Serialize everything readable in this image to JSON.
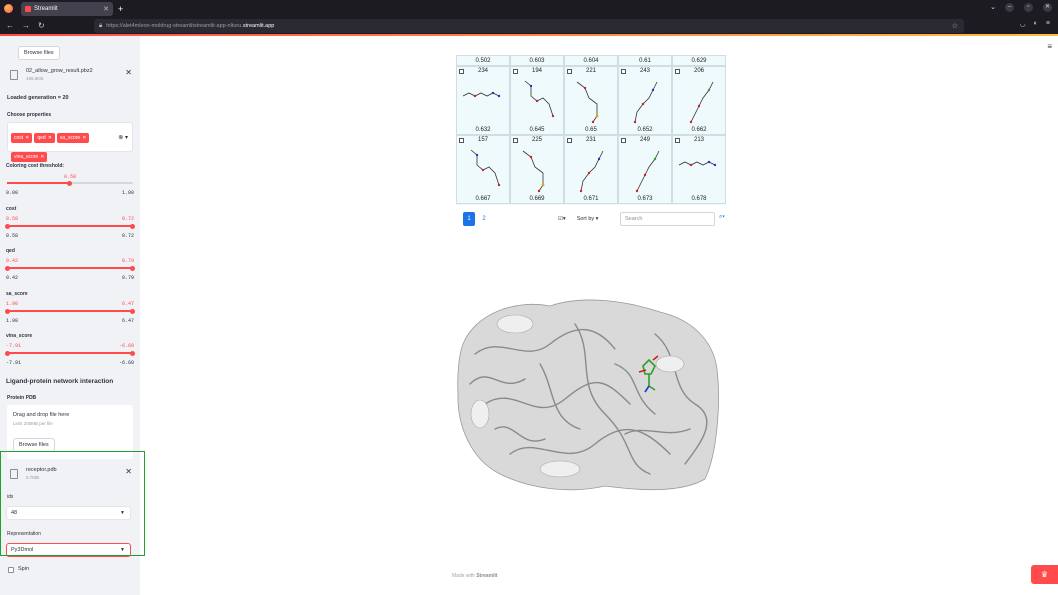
{
  "browser": {
    "tab_title": "Streamlit",
    "url_path": "https://alet4mleon-moldrug-streamlitstreamlit-app-nlturu.",
    "url_host": "streamlit.app"
  },
  "sidebar": {
    "browse_files_label": "Browse files",
    "uploaded_file": {
      "name": "02_allow_grow_result.pbz2",
      "size": "166.5KB"
    },
    "loaded_generation": "Loaded generation = 20",
    "choose_properties_label": "Choose properties",
    "properties": [
      "cost",
      "qed",
      "sa_score",
      "vina_score"
    ],
    "coloring_threshold": {
      "label": "Coloring cost threshold:",
      "value": "0.58",
      "min": "0.00",
      "max": "1.00",
      "fraction": 0.5
    },
    "range_sliders": [
      {
        "name": "cost",
        "low": "0.58",
        "high": "0.72",
        "min": "0.58",
        "max": "0.72"
      },
      {
        "name": "qed",
        "low": "0.42",
        "high": "0.79",
        "min": "0.42",
        "max": "0.79"
      },
      {
        "name": "sa_score",
        "low": "1.90",
        "high": "6.47",
        "min": "1.90",
        "max": "6.47"
      },
      {
        "name": "vina_score",
        "low": "-7.91",
        "high": "-6.60",
        "min": "-7.91",
        "max": "-6.60"
      }
    ],
    "network_header": "Ligand-protein network interaction",
    "protein_pdb_label": "Protein PDB",
    "dropzone": {
      "title": "Drag and drop file here",
      "limit": "Limit 200MB per file",
      "button": "Browse files"
    },
    "receptor_file": {
      "name": "receptor.pdb",
      "size": "0.7MB"
    },
    "idx": {
      "label": "idx",
      "value": "48"
    },
    "representation": {
      "label": "Representation",
      "value": "Py3Dmol"
    },
    "spin_label": "Spin"
  },
  "grid": {
    "top_row_scores": [
      "0.502",
      "0.603",
      "0.604",
      "0.61",
      "0.629"
    ],
    "rows": [
      [
        {
          "id": "234",
          "score": "0.632"
        },
        {
          "id": "194",
          "score": "0.645"
        },
        {
          "id": "221",
          "score": "0.65"
        },
        {
          "id": "243",
          "score": "0.652"
        },
        {
          "id": "206",
          "score": "0.662"
        }
      ],
      [
        {
          "id": "157",
          "score": "0.667"
        },
        {
          "id": "225",
          "score": "0.669"
        },
        {
          "id": "231",
          "score": "0.671"
        },
        {
          "id": "249",
          "score": "0.673"
        },
        {
          "id": "213",
          "score": "0.678"
        }
      ]
    ],
    "pages": [
      "1",
      "2"
    ],
    "sort_label": "Sort by",
    "search_placeholder": "Search"
  },
  "footer": {
    "made_with": "Made with",
    "brand": "Streamlit"
  },
  "colors": {
    "accent": "#ff4b4b",
    "highlight": "#1fa32a",
    "grid_bg": "#effafc"
  }
}
